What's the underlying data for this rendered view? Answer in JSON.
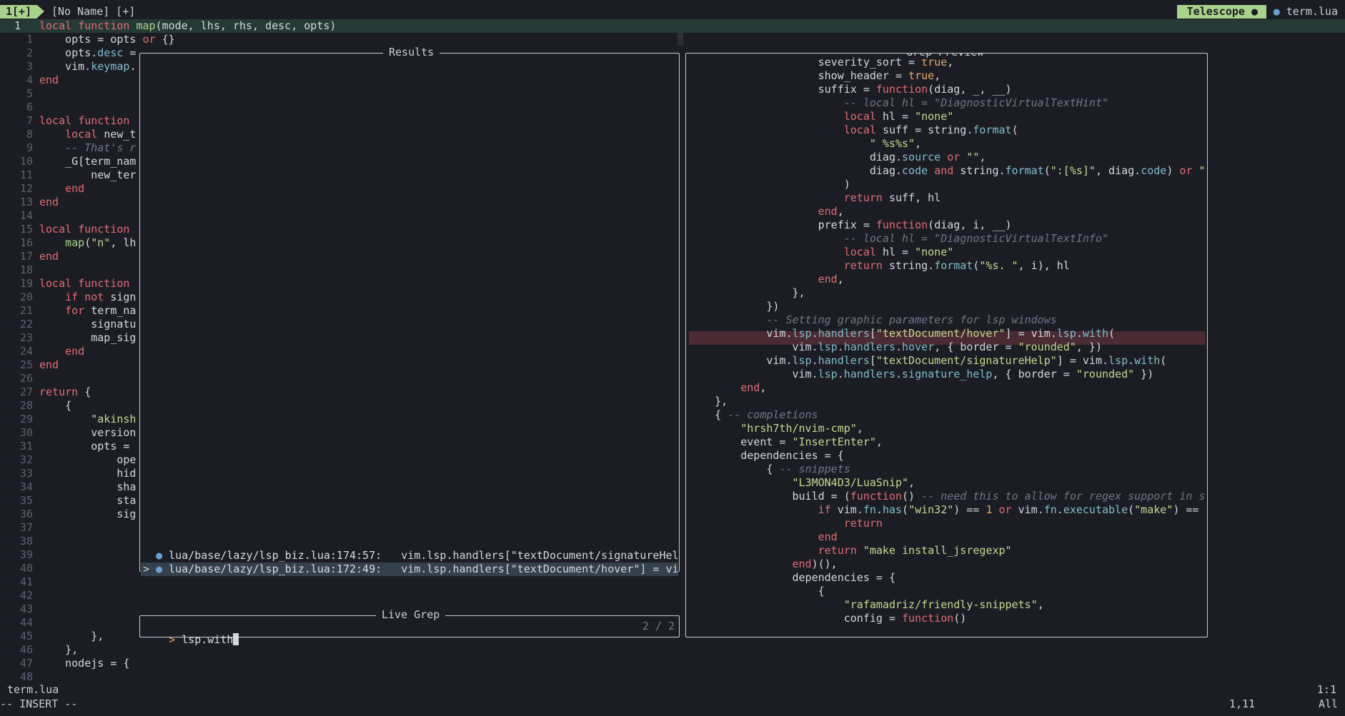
{
  "tabline": {
    "active_tab": "1[+]",
    "buffer_name": "[No Name] [+]",
    "telescope_label": "Telescope ●",
    "file_label": "term.lua"
  },
  "editor": {
    "gutter": [
      "1",
      "1",
      "2",
      "3",
      "4",
      "5",
      "6",
      "7",
      "8",
      "9",
      "10",
      "11",
      "12",
      "13",
      "14",
      "15",
      "16",
      "17",
      "18",
      "19",
      "20",
      "21",
      "22",
      "23",
      "24",
      "25",
      "26",
      "27",
      "28",
      "29",
      "30",
      "31",
      "32",
      "33",
      "34",
      "35",
      "36",
      "37",
      "38",
      "39",
      "40",
      "41",
      "42",
      "43",
      "44",
      "45",
      "46",
      "47",
      "48"
    ],
    "lines": [
      "local function map(mode, lhs, rhs, desc, opts)",
      "    opts = opts or {}",
      "    opts.desc =",
      "    vim.keymap.",
      "end",
      "",
      "",
      "local function",
      "    local new_t",
      "    -- That's r",
      "    _G[term_nam",
      "        new_ter",
      "    end",
      "end",
      "",
      "local function",
      "    map(\"n\", lh",
      "end",
      "",
      "local function",
      "    if not sign",
      "    for term_na",
      "        signatu",
      "        map_sig",
      "    end",
      "end",
      "",
      "return {",
      "    {",
      "        \"akinsh",
      "        version",
      "        opts =",
      "            ope",
      "            hid",
      "            sha",
      "            sta",
      "            sig",
      "",
      "",
      "",
      "",
      "",
      "",
      "",
      "",
      "        },",
      "    },",
      "    nodejs = {"
    ]
  },
  "results": {
    "title": "Results",
    "entries": [
      {
        "prefix": "  ",
        "path": "lua/base/lazy/lsp_biz.lua:174:57:",
        "text": "   vim.lsp.handlers[\"textDocument/signatureHel"
      },
      {
        "prefix": "> ",
        "path": "lua/base/lazy/lsp_biz.lua:172:49:",
        "text": "   vim.lsp.handlers[\"textDocument/hover\"] = vi"
      }
    ]
  },
  "prompt": {
    "title": "Live Grep",
    "marker": ">",
    "query": "lsp.with",
    "count": "2 / 2"
  },
  "preview": {
    "title": "Grep Preview",
    "lines": [
      "                severity_sort = true,",
      "                show_header = true,",
      "                suffix = function(diag, _, __)",
      "                    -- local hl = \"DiagnosticVirtualTextHint\"",
      "                    local hl = \"none\"",
      "                    local suff = string.format(",
      "                        \" %s%s\",",
      "                        diag.source or \"\",",
      "                        diag.code and string.format(\":[%s]\", diag.code) or \"",
      "                    )",
      "                    return suff, hl",
      "                end,",
      "                prefix = function(diag, i, __)",
      "                    -- local hl = \"DiagnosticVirtualTextInfo\"",
      "                    local hl = \"none\"",
      "                    return string.format(\"%s. \", i), hl",
      "                end,",
      "            },",
      "        })",
      "        -- Setting graphic parameters for lsp windows",
      "        vim.lsp.handlers[\"textDocument/hover\"] = vim.lsp.with(",
      "            vim.lsp.handlers.hover, { border = \"rounded\", })",
      "        vim.lsp.handlers[\"textDocument/signatureHelp\"] = vim.lsp.with(",
      "            vim.lsp.handlers.signature_help, { border = \"rounded\" })",
      "    end,",
      "},",
      "{ -- completions",
      "    \"hrsh7th/nvim-cmp\",",
      "    event = \"InsertEnter\",",
      "    dependencies = {",
      "        { -- snippets",
      "            \"L3MON4D3/LuaSnip\",",
      "            build = (function() -- need this to allow for regex support in s",
      "                if vim.fn.has(\"win32\") == 1 or vim.fn.executable(\"make\") ==",
      "                    return",
      "                end",
      "                return \"make install_jsregexp\"",
      "            end)(),",
      "            dependencies = {",
      "                {",
      "                    \"rafamadriz/friendly-snippets\",",
      "                    config = function()"
    ]
  },
  "statusline": {
    "file": "term.lua",
    "position_top": "1:1"
  },
  "cmdline": {
    "mode": "-- INSERT --",
    "cursor": "1,11",
    "scroll": "All"
  },
  "colors": {
    "background": "#1c1d24",
    "accent_green": "#a9d28b",
    "selection": "#34404b",
    "preview_highlight": "#4a2b33"
  }
}
